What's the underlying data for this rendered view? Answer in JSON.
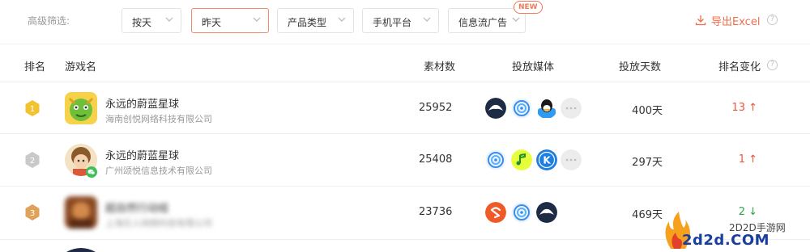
{
  "filter": {
    "label": "高级筛选:",
    "dropdowns": [
      "按天",
      "昨天",
      "产品类型",
      "手机平台",
      "信息流广告"
    ],
    "new_badge": "NEW",
    "export_label": "导出Excel"
  },
  "table": {
    "headers": {
      "rank": "排名",
      "game": "游戏名",
      "count": "素材数",
      "media": "投放媒体",
      "days": "投放天数",
      "change": "排名变化"
    },
    "rows": [
      {
        "rank": "1",
        "name": "永远的蔚蓝星球",
        "company": "海南创悦网络科技有限公司",
        "count": "25952",
        "media": [
          "eagle-icon",
          "swirl-icon",
          "qq-penguin-icon",
          "more-icon"
        ],
        "days": "400天",
        "change": "13 ↑",
        "direction": "up"
      },
      {
        "rank": "2",
        "name": "永远的蔚蓝星球",
        "company": "广州颂悦信息技术有限公司",
        "count": "25408",
        "media": [
          "swirl-icon",
          "green-note-icon",
          "k-icon",
          "more-icon"
        ],
        "days": "297天",
        "change": "1 ↑",
        "direction": "up"
      },
      {
        "rank": "3",
        "name": "超自然行动组",
        "company": "上海巨人网络科技有限公司",
        "count": "23736",
        "media": [
          "orange-arrow-icon",
          "swirl-icon",
          "eagle-icon"
        ],
        "days": "469天",
        "change": "2 ↓",
        "direction": "down"
      }
    ]
  },
  "watermark": {
    "line1": "2D2D手游网",
    "line2": "2d2d.COM"
  },
  "colors": {
    "accent": "#f06c4a",
    "up": "#f0553a",
    "down": "#2fa34a",
    "gold": "#f3c232",
    "silver": "#c9c9c9",
    "bronze": "#e0a25a"
  }
}
